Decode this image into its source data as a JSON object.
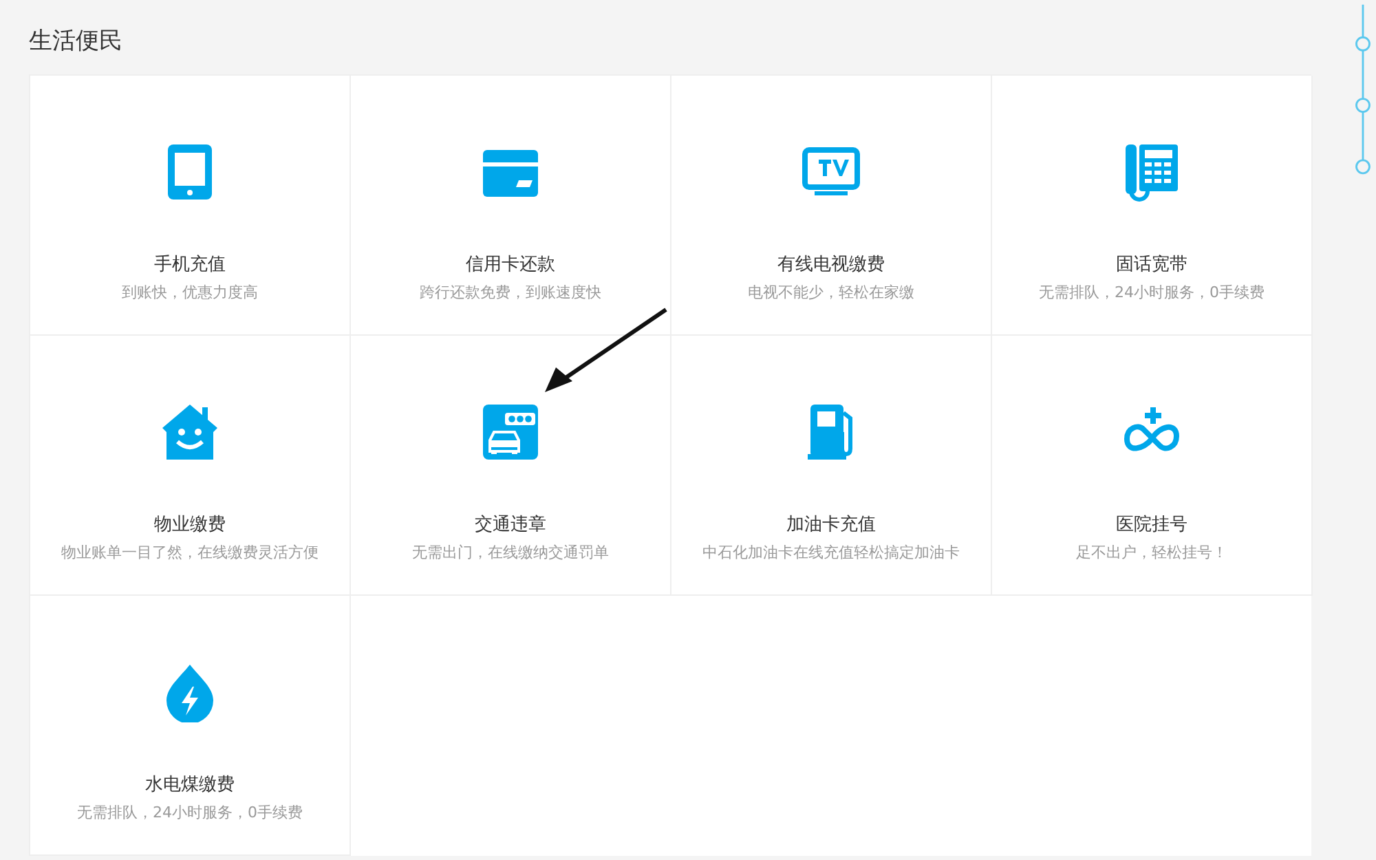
{
  "section": {
    "title": "生活便民"
  },
  "services": [
    {
      "kind": "phone",
      "title": "手机充值",
      "subtitle": "到账快，优惠力度高"
    },
    {
      "kind": "card",
      "title": "信用卡还款",
      "subtitle": "跨行还款免费，到账速度快"
    },
    {
      "kind": "tv",
      "title": "有线电视缴费",
      "subtitle": "电视不能少，轻松在家缴"
    },
    {
      "kind": "telephone",
      "title": "固话宽带",
      "subtitle": "无需排队，24小时服务，0手续费"
    },
    {
      "kind": "house",
      "title": "物业缴费",
      "subtitle": "物业账单一目了然，在线缴费灵活方便"
    },
    {
      "kind": "traffic",
      "title": "交通违章",
      "subtitle": "无需出门，在线缴纳交通罚单"
    },
    {
      "kind": "fuel",
      "title": "加油卡充值",
      "subtitle": "中石化加油卡在线充值轻松搞定加油卡"
    },
    {
      "kind": "hospital",
      "title": "医院挂号",
      "subtitle": "足不出户，轻松挂号！"
    },
    {
      "kind": "drop",
      "title": "水电煤缴费",
      "subtitle": "无需排队，24小时服务，0手续费"
    }
  ]
}
